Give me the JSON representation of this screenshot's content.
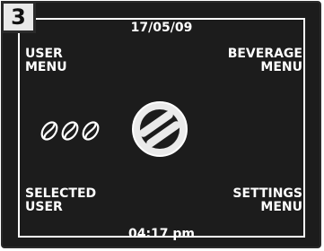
{
  "step_number": "3",
  "header": {
    "date": "17/05/09"
  },
  "footer": {
    "time": "04:17 pm"
  },
  "corners": {
    "top_left": {
      "line1": "USER",
      "line2": "MENU"
    },
    "top_right": {
      "line1": "BEVERAGE",
      "line2": "MENU"
    },
    "bottom_left": {
      "line1": "SELECTED",
      "line2": "USER"
    },
    "bottom_right": {
      "line1": "SETTINGS",
      "line2": "MENU"
    }
  },
  "icons": {
    "left": "coffee-beans-icon",
    "center": "brand-logo-icon"
  },
  "colors": {
    "background": "#1c1c1c",
    "text": "#ffffff",
    "badge": "#e9e9e9"
  }
}
